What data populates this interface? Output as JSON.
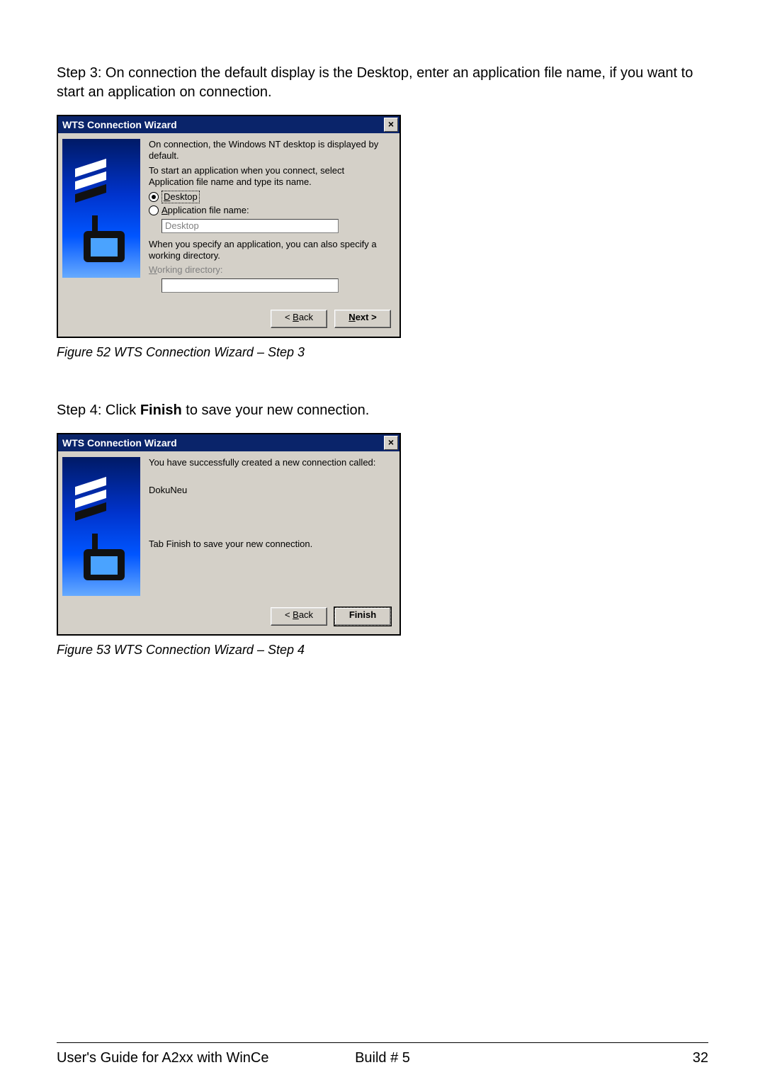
{
  "intro3": "Step 3: On connection the default display is the Desktop, enter an application file name, if you want to start an application on connection.",
  "intro4_prefix": "Step 4: Click ",
  "intro4_bold": "Finish",
  "intro4_suffix": " to save your new connection.",
  "caption1": "Figure 52 WTS Connection Wizard – Step 3",
  "caption2": "Figure 53 WTS Connection Wizard – Step 4",
  "dialog": {
    "title": "WTS Connection Wizard",
    "close": "×"
  },
  "d1": {
    "p1": "On connection, the Windows NT desktop is displayed by default.",
    "p2": "To start an application when you connect, select Application file name and type its name.",
    "opt_desktop_u": "D",
    "opt_desktop_rest": "esktop",
    "opt_app_u": "A",
    "opt_app_rest": "pplication file name:",
    "app_value": "Desktop",
    "p3": "When you specify an application, you can also specify a working directory.",
    "wdir_u": "W",
    "wdir_rest": "orking directory:",
    "wdir_value": ""
  },
  "d2": {
    "p1": "You have successfully created a new connection called:",
    "name": "DokuNeu",
    "p2": "Tab Finish to save your new connection."
  },
  "buttons": {
    "back_lt": "< ",
    "back_u": "B",
    "back_rest": "ack",
    "next_u": "N",
    "next_rest": "ext >",
    "finish": "Finish"
  },
  "footer": {
    "left": "User's Guide for A2xx with WinCe",
    "center": "Build # 5",
    "right": "32"
  }
}
